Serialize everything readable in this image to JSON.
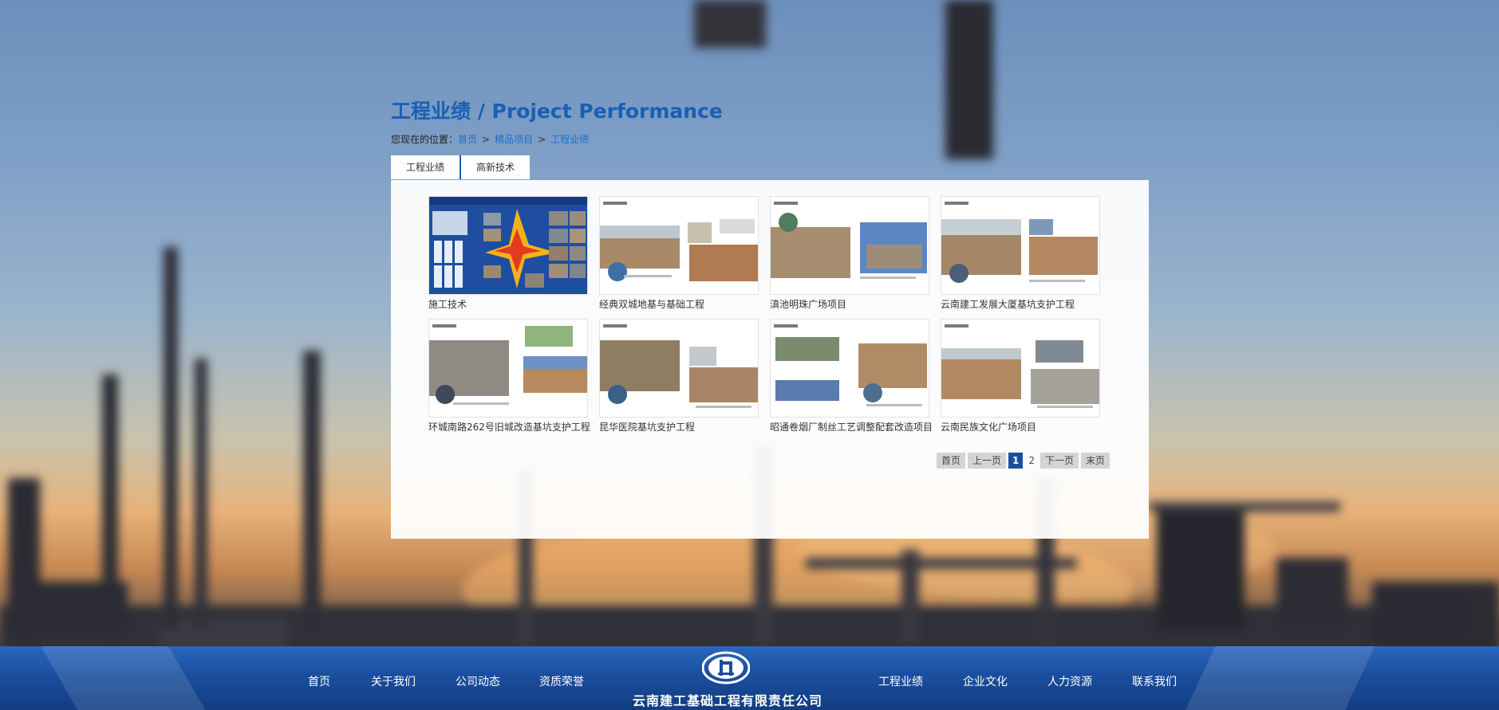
{
  "page": {
    "title": "工程业绩 / Project Performance"
  },
  "breadcrumb": {
    "prefix": "您现在的位置：",
    "items": [
      "首页",
      "精品项目",
      "工程业绩"
    ],
    "separator": ">"
  },
  "tabs": [
    {
      "label": "工程业绩"
    },
    {
      "label": "高新技术"
    }
  ],
  "projects": [
    {
      "caption": "施工技术"
    },
    {
      "caption": "经典双城地基与基础工程"
    },
    {
      "caption": "滇池明珠广场项目"
    },
    {
      "caption": "云南建工发展大厦基坑支护工程"
    },
    {
      "caption": "环城南路262号旧城改造基坑支护工程"
    },
    {
      "caption": "昆华医院基坑支护工程"
    },
    {
      "caption": "昭通卷烟厂制丝工艺调整配套改造项目"
    },
    {
      "caption": "云南民族文化广场项目"
    }
  ],
  "pagination": {
    "first": "首页",
    "prev": "上一页",
    "pages": [
      "1",
      "2"
    ],
    "current": "1",
    "next": "下一页",
    "last": "末页"
  },
  "footer": {
    "nav_left": [
      "首页",
      "关于我们",
      "公司动态",
      "资质荣誉"
    ],
    "nav_right": [
      "工程业绩",
      "企业文化",
      "人力资源",
      "联系我们"
    ],
    "company_name": "云南建工基础工程有限责任公司"
  },
  "colors": {
    "accent": "#1a5fb4",
    "link": "#1c6fd1",
    "footer": "#1a4e9e"
  }
}
